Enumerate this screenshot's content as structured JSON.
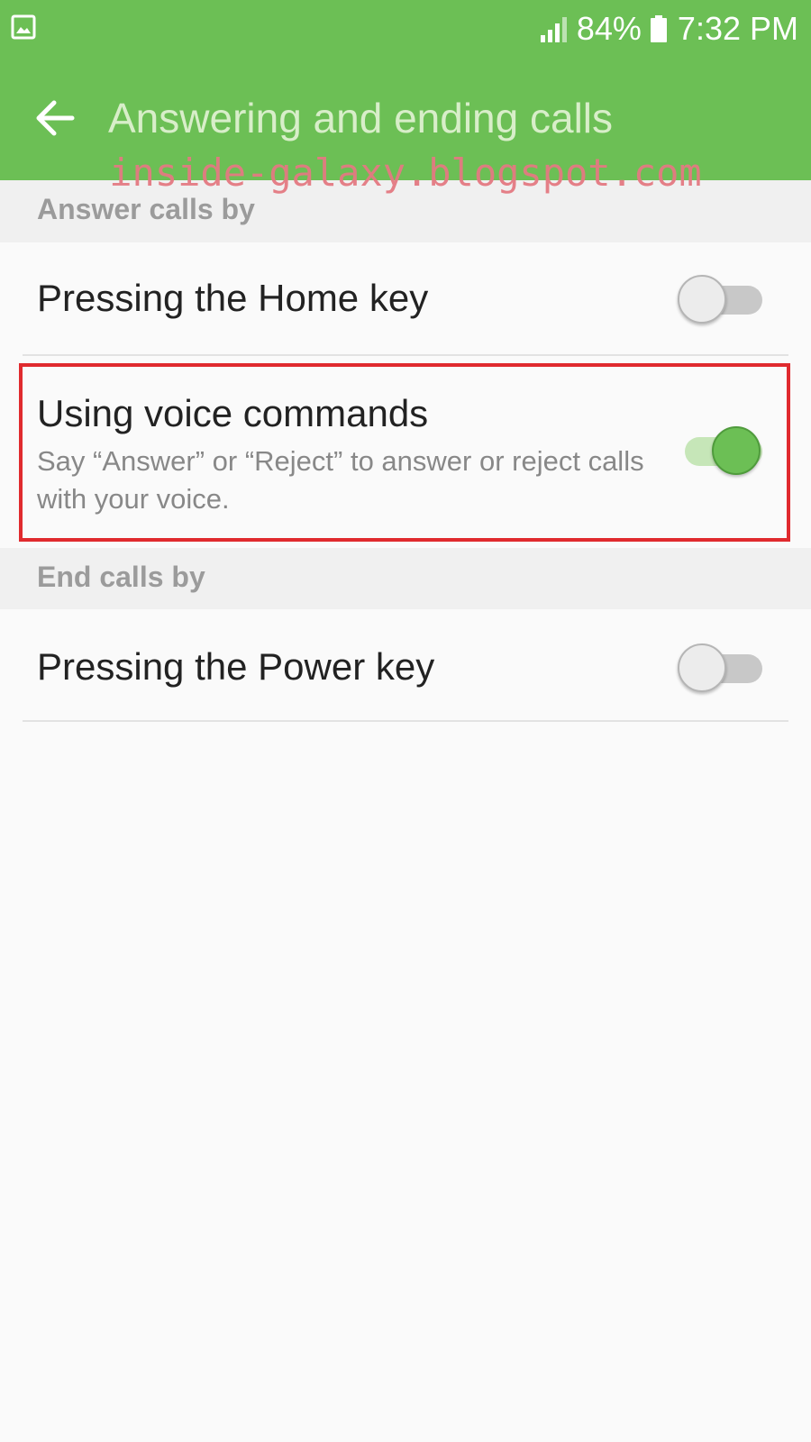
{
  "status_bar": {
    "battery_percent": "84%",
    "time": "7:32 PM",
    "icons": [
      "gallery-icon",
      "signal-icon",
      "battery-icon"
    ]
  },
  "header": {
    "title": "Answering and ending calls",
    "back_icon": "arrow-left-icon"
  },
  "watermark": "inside-galaxy.blogspot.com",
  "sections": {
    "answer": {
      "header": "Answer calls by",
      "home_key": {
        "title": "Pressing the Home key",
        "enabled": false
      },
      "voice_commands": {
        "title": "Using voice commands",
        "description": "Say “Answer” or “Reject” to answer or reject calls with your voice.",
        "enabled": true
      }
    },
    "end": {
      "header": "End calls by",
      "power_key": {
        "title": "Pressing the Power key",
        "enabled": false
      }
    }
  },
  "colors": {
    "accent": "#6cbf55",
    "highlight_box": "#e02a2e",
    "watermark": "#e47a82"
  }
}
